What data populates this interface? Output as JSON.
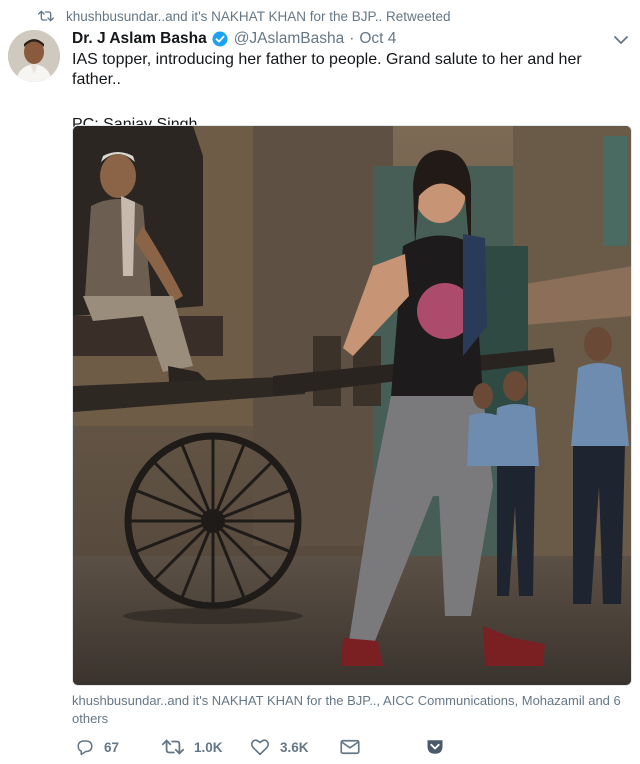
{
  "retweet": {
    "text": "khushbusundar..and it's NAKHAT KHAN for the BJP.. Retweeted",
    "icon": "retweet-icon"
  },
  "tweet": {
    "author_name": "Dr. J Aslam Basha",
    "handle": "@JAslamBasha",
    "separator": "·",
    "date": "Oct 4",
    "text_line1": "IAS topper, introducing her father to people. Grand salute to her and her father..",
    "text_line2": "PC: Sanjay Singh",
    "verified_color": "#1da1f2"
  },
  "liked_by": {
    "text": "khushbusundar..and it's NAKHAT KHAN for the BJP.., AICC Communications, Mohazamil and 6 others"
  },
  "actions": {
    "reply_count": "67",
    "retweet_count": "1.0K",
    "like_count": "3.6K",
    "icons": [
      "reply-icon",
      "retweet-icon",
      "like-icon",
      "message-icon",
      "pocket-icon"
    ]
  },
  "colors": {
    "text_primary": "#14171a",
    "text_secondary": "#657786",
    "accent": "#1da1f2",
    "pocket": "#4a5a6a"
  }
}
